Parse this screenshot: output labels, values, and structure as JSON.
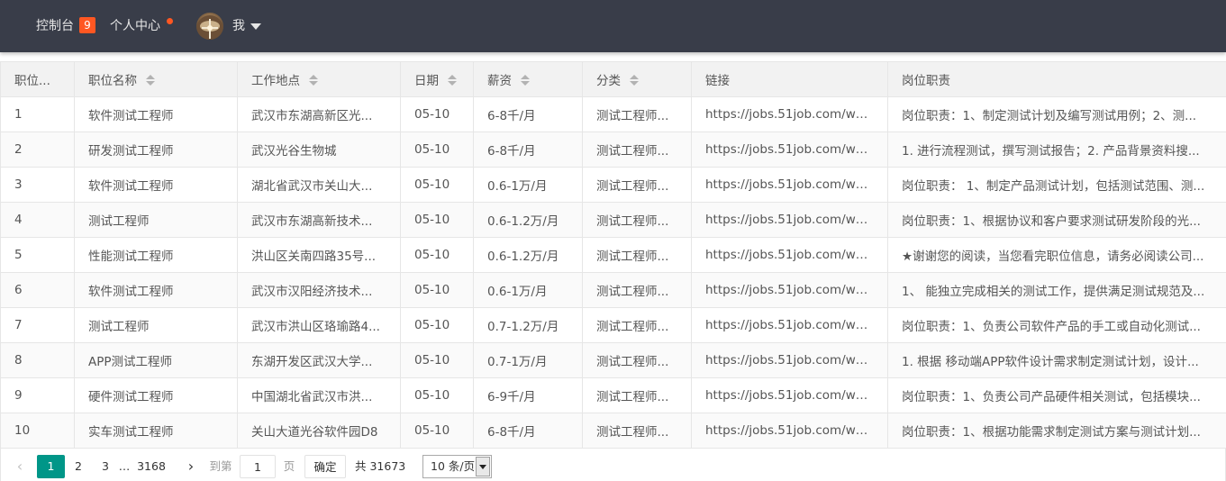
{
  "header": {
    "console_label": "控制台",
    "console_badge": "9",
    "personal_label": "个人中心",
    "user_label": "我"
  },
  "table": {
    "columns": [
      "职位...",
      "职位名称",
      "工作地点",
      "日期",
      "薪资",
      "分类",
      "链接",
      "岗位职责"
    ],
    "rows": [
      [
        "1",
        "软件测试工程师",
        "武汉市东湖高新区光...",
        "05-10",
        "6-8千/月",
        "测试工程师...",
        "https://jobs.51job.com/wuh...",
        "岗位职责：1、制定测试计划及编写测试用例；2、测..."
      ],
      [
        "2",
        "研发测试工程师",
        "武汉光谷生物城",
        "05-10",
        "6-8千/月",
        "测试工程师...",
        "https://jobs.51job.com/wuh...",
        "1. 进行流程测试，撰写测试报告；2. 产品背景资料搜..."
      ],
      [
        "3",
        "软件测试工程师",
        "湖北省武汉市关山大...",
        "05-10",
        "0.6-1万/月",
        "测试工程师...",
        "https://jobs.51job.com/wuh...",
        "岗位职责： 1、制定产品测试计划，包括测试范围、测..."
      ],
      [
        "4",
        "测试工程师",
        "武汉市东湖高新技术...",
        "05-10",
        "0.6-1.2万/月",
        "测试工程师...",
        "https://jobs.51job.com/wuh...",
        "岗位职责：1、根据协议和客户要求测试研发阶段的光..."
      ],
      [
        "5",
        "性能测试工程师",
        "洪山区关南四路35号...",
        "05-10",
        "0.6-1.2万/月",
        "测试工程师...",
        "https://jobs.51job.com/wuh...",
        "★谢谢您的阅读，当您看完职位信息，请务必阅读公司..."
      ],
      [
        "6",
        "软件测试工程师",
        "武汉市汉阳经济技术...",
        "05-10",
        "0.6-1万/月",
        "测试工程师...",
        "https://jobs.51job.com/wuh...",
        "1、 能独立完成相关的测试工作，提供满足测试规范及..."
      ],
      [
        "7",
        "测试工程师",
        "武汉市洪山区珞瑜路4...",
        "05-10",
        "0.7-1.2万/月",
        "测试工程师...",
        "https://jobs.51job.com/wuh...",
        "岗位职责：1、负责公司软件产品的手工或自动化测试..."
      ],
      [
        "8",
        "APP测试工程师",
        "东湖开发区武汉大学...",
        "05-10",
        "0.7-1万/月",
        "测试工程师...",
        "https://jobs.51job.com/wuh...",
        "1. 根据 移动端APP软件设计需求制定测试计划，设计..."
      ],
      [
        "9",
        "硬件测试工程师",
        "中国湖北省武汉市洪...",
        "05-10",
        "6-9千/月",
        "测试工程师...",
        "https://jobs.51job.com/wuh...",
        "岗位职责：1、负责公司产品硬件相关测试，包括模块..."
      ],
      [
        "10",
        "实车测试工程师",
        "关山大道光谷软件园D8",
        "05-10",
        "6-8千/月",
        "测试工程师...",
        "https://jobs.51job.com/wuh...",
        "岗位职责：1、根据功能需求制定测试方案与测试计划..."
      ]
    ]
  },
  "pagination": {
    "prev": "‹",
    "current": "1",
    "page2": "2",
    "page3": "3",
    "ellipsis": "…",
    "last": "3168",
    "next": "›",
    "goto_label": "到第",
    "goto_value": "1",
    "page_label": "页",
    "confirm_label": "确定",
    "total_label": "共 31673 条",
    "page_size": "10 条/页"
  },
  "colors": {
    "topbar": "#393d49",
    "accent": "#009688",
    "badge": "#ff5722"
  }
}
